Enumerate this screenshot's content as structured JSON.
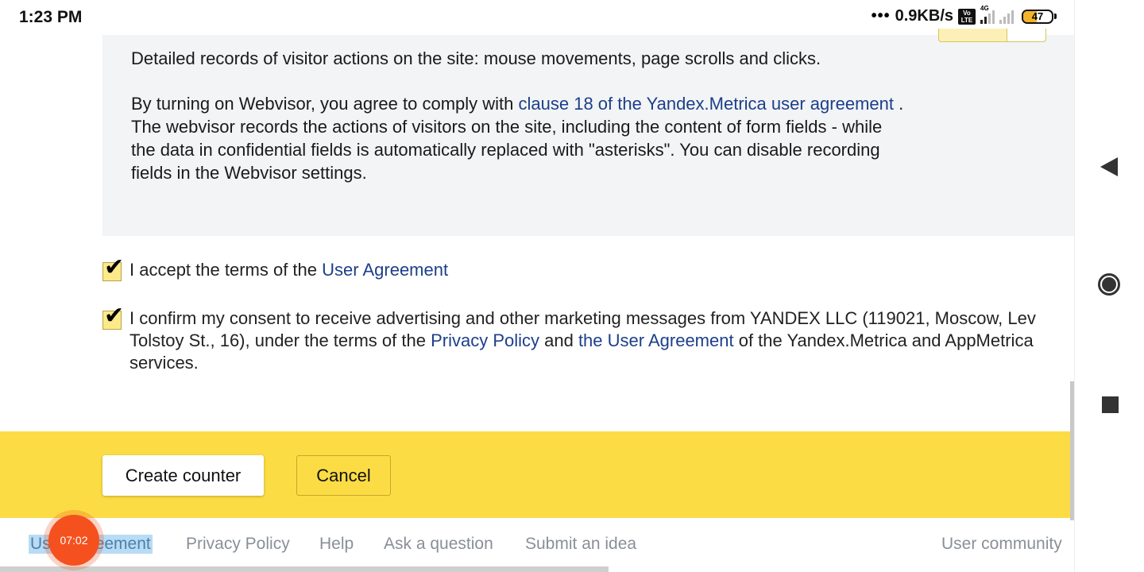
{
  "status_bar": {
    "time": "1:23 PM",
    "more_indicator": "•••",
    "network_speed": "0.9KB/s",
    "volte_label": "Vo LTE",
    "network_type": "4G",
    "battery_level": "47"
  },
  "info_box": {
    "paragraph1": "Detailed records of visitor actions on the site: mouse movements, page scrolls and clicks.",
    "p2_text_before": "By turning on Webvisor, you agree to comply with ",
    "p2_link": "clause 18 of the Yandex.Metrica user agreement",
    "p2_text_after": " . The webvisor records the actions of visitors on the site, including the content of form fields - while the data in confidential fields is automatically replaced with \"asterisks\". You can disable recording fields in the Webvisor settings."
  },
  "consent": {
    "checkbox1": {
      "checked": true,
      "text_before": "I accept the terms  of the ",
      "link": "User Agreement"
    },
    "checkbox2": {
      "checked": true,
      "text_before": "I confirm my consent to receive advertising and other marketing messages from YANDEX LLC (119021, Moscow, Lev Tolstoy St., 16), under the terms of the ",
      "link1": "Privacy Policy",
      "text_mid": " and ",
      "link2": "the User Agreement",
      "text_after": " of the Yandex.Metrica and AppMetrica services."
    },
    "check_glyph": "✔"
  },
  "actions": {
    "create_label": "Create counter",
    "cancel_label": "Cancel"
  },
  "footer": {
    "links": [
      "User Agreement",
      "Privacy Policy",
      "Help",
      "Ask a question",
      "Submit an idea",
      "User community"
    ]
  },
  "recorder": {
    "timer": "07:02"
  },
  "colors": {
    "accent_yellow": "#fcdc44",
    "link_blue": "#1d3f8a",
    "recorder_orange": "#f4511e"
  }
}
